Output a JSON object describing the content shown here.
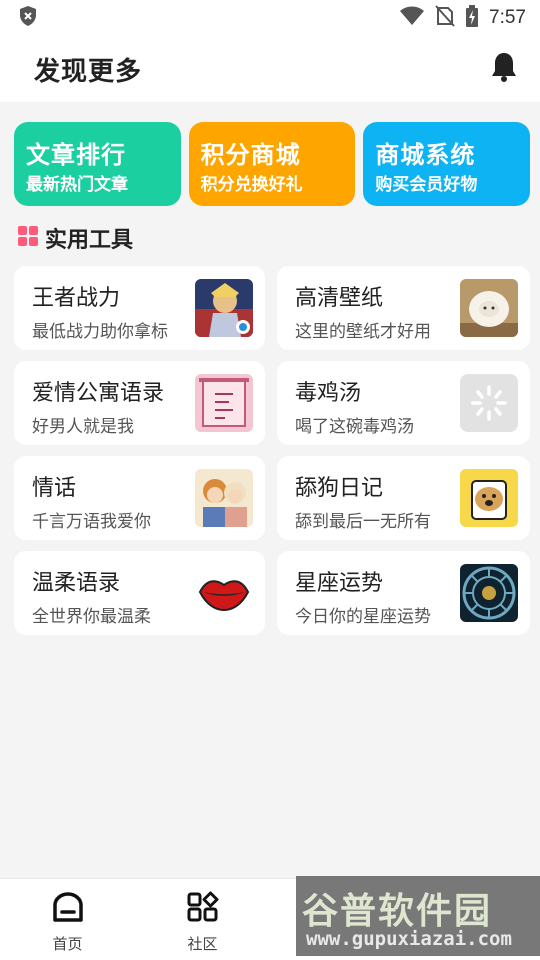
{
  "status_bar": {
    "time": "7:57",
    "icons": [
      "shield-icon",
      "wifi-icon",
      "no-sim-icon",
      "battery-charging-icon"
    ]
  },
  "header": {
    "title": "发现更多",
    "icon": "bell-icon"
  },
  "banners": [
    {
      "title": "文章排行",
      "subtitle": "最新热门文章",
      "color": "#1ccfa0"
    },
    {
      "title": "积分商城",
      "subtitle": "积分兑换好礼",
      "color": "#fea500"
    },
    {
      "title": "商城系统",
      "subtitle": "购买会员好物",
      "color": "#0db3f3"
    }
  ],
  "section": {
    "title": "实用工具",
    "icon": "grid-dots-icon",
    "icon_color": "#ff5a7a"
  },
  "tools": [
    {
      "title": "王者战力",
      "subtitle": "最低战力助你拿标",
      "thumb": "game-hero-thumb"
    },
    {
      "title": "高清壁纸",
      "subtitle": "这里的壁纸才好用",
      "thumb": "sheep-plush-thumb"
    },
    {
      "title": "爱情公寓语录",
      "subtitle": "好男人就是我",
      "thumb": "love-apartment-thumb"
    },
    {
      "title": "毒鸡汤",
      "subtitle": "喝了这碗毒鸡汤",
      "thumb": "loading-spinner-thumb"
    },
    {
      "title": "情话",
      "subtitle": "千言万语我爱你",
      "thumb": "couple-illustration-thumb"
    },
    {
      "title": "舔狗日记",
      "subtitle": "舔到最后一无所有",
      "thumb": "dog-cartoon-thumb"
    },
    {
      "title": "温柔语录",
      "subtitle": "全世界你最温柔",
      "thumb": "red-lips-thumb"
    },
    {
      "title": "星座运势",
      "subtitle": "今日你的星座运势",
      "thumb": "zodiac-wheel-thumb"
    }
  ],
  "bottom_nav": [
    {
      "label": "首页",
      "icon": "home-icon"
    },
    {
      "label": "社区",
      "icon": "apps-icon"
    }
  ],
  "watermark": {
    "text": "谷普软件园",
    "url": "www.gupuxiazai.com"
  }
}
